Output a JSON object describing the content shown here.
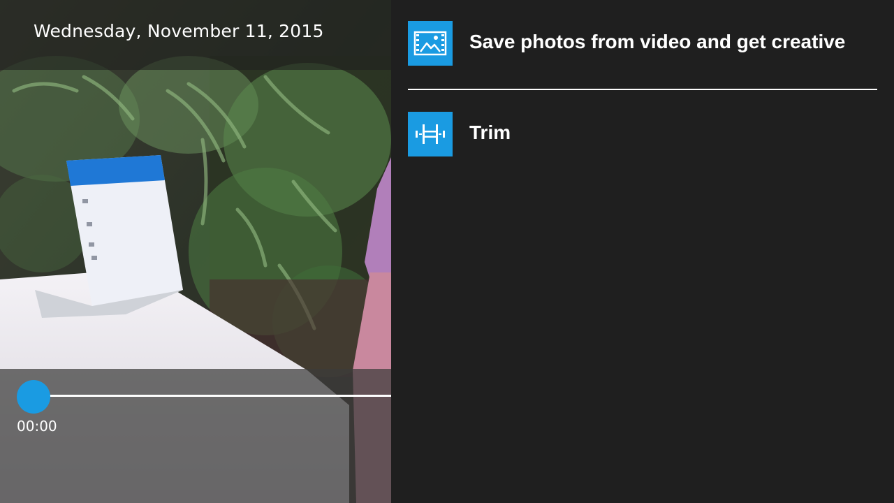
{
  "video": {
    "date": "Wednesday, November 11, 2015",
    "current_time": "00:00",
    "progress": 0
  },
  "menu": {
    "items": [
      {
        "label": "Save photos from video and get creative",
        "icon": "photo-film-icon"
      },
      {
        "label": "Trim",
        "icon": "trim-icon"
      }
    ]
  },
  "colors": {
    "accent": "#1a9be2",
    "menu_background": "#1f1f1f",
    "text": "#ffffff"
  }
}
